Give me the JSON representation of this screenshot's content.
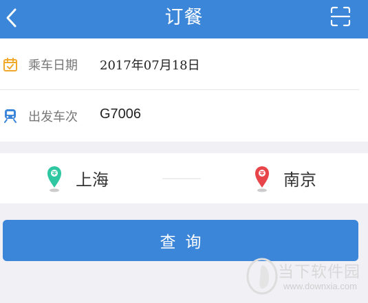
{
  "header": {
    "title": "订餐",
    "background": "#3b86d8",
    "back_icon": "chevron-left-icon",
    "scan_icon": "scan-icon"
  },
  "form": {
    "date_row": {
      "icon": "calendar-icon",
      "label": "乘车日期",
      "value": "2017年07月18日"
    },
    "train_row": {
      "icon": "train-icon",
      "label": "出发车次",
      "value": "G7006"
    }
  },
  "route": {
    "from": {
      "name": "上海",
      "pin_color": "#2ec7a1"
    },
    "to": {
      "name": "南京",
      "pin_color": "#e8454a"
    }
  },
  "query_button": {
    "label": "查询",
    "color": "#3b86d8"
  },
  "watermark": {
    "title": "当下软件园",
    "url": "www.downxia.com"
  }
}
